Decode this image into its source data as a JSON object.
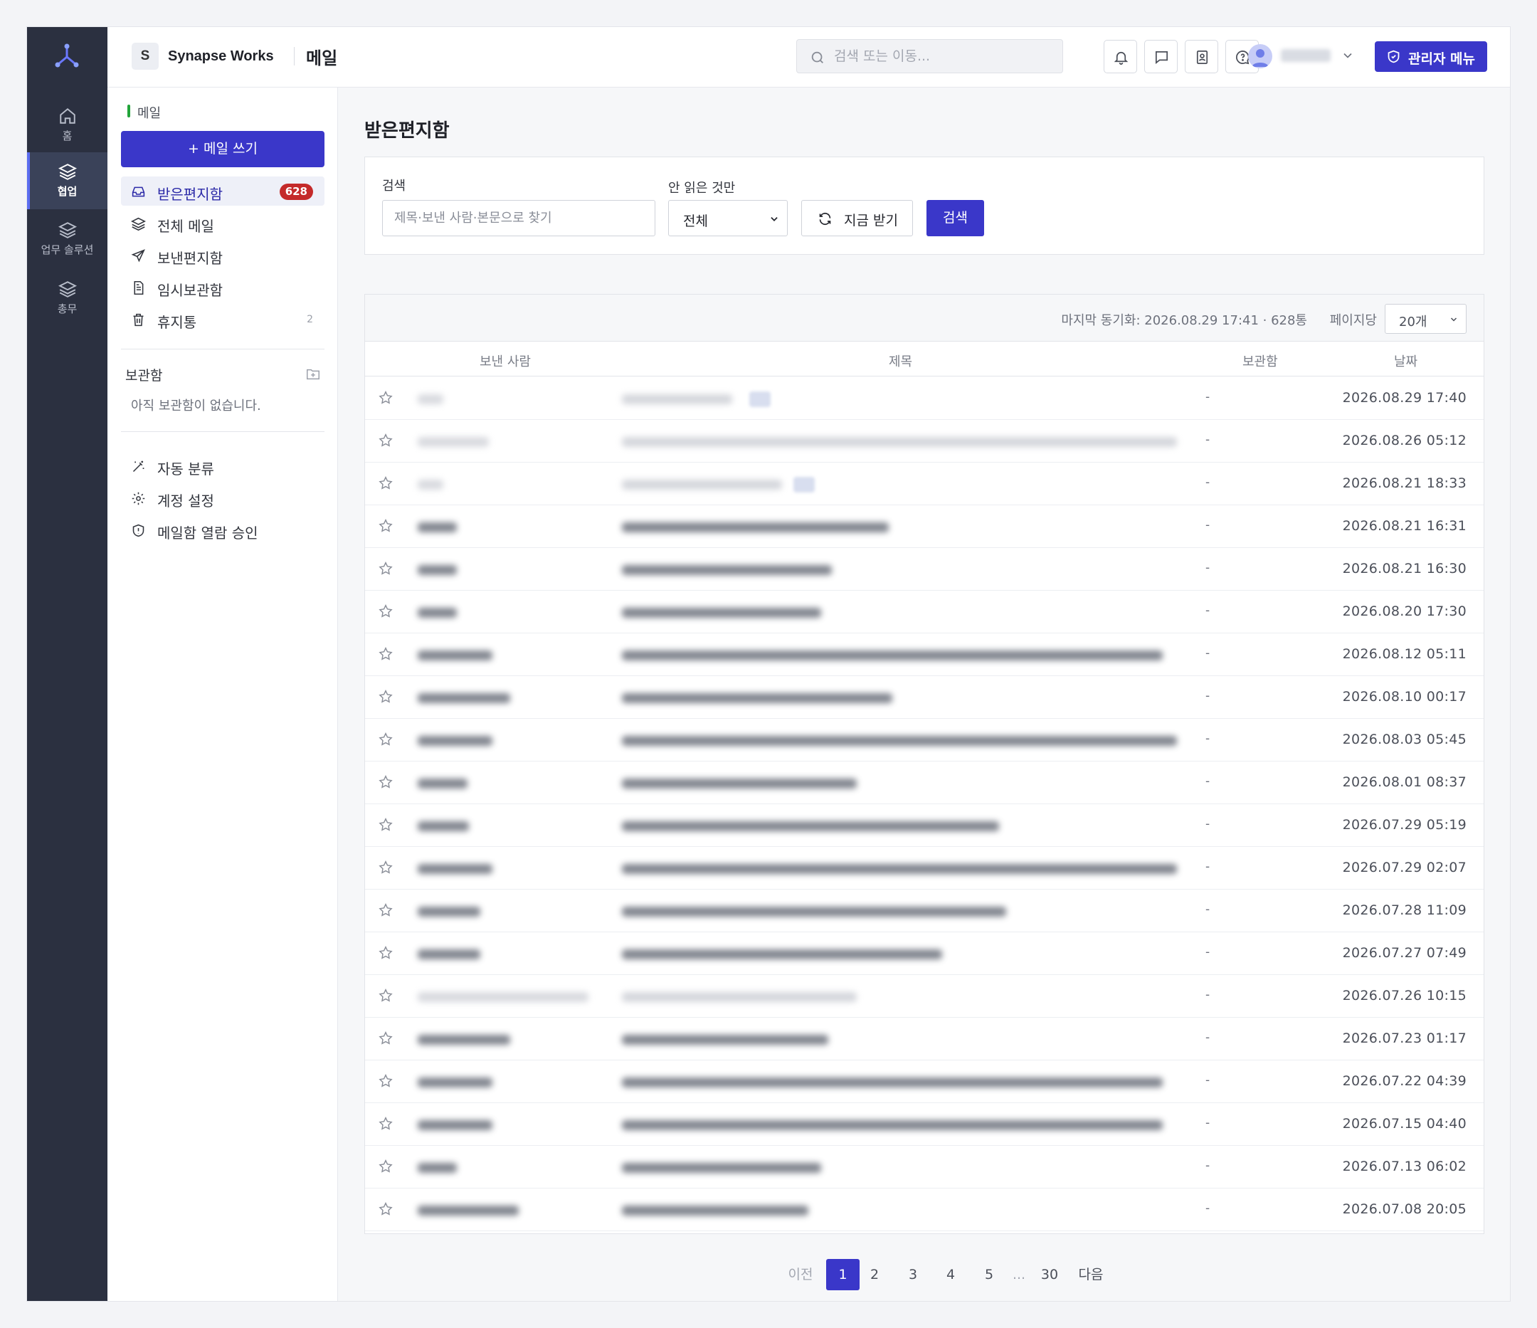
{
  "header": {
    "workspace_initial": "S",
    "workspace_name": "Synapse Works",
    "app_title": "메일",
    "search_placeholder": "검색 또는 이동...",
    "admin_label": "관리자 메뉴"
  },
  "rail": {
    "items": [
      {
        "label": "홈",
        "icon": "home-icon"
      },
      {
        "label": "협업",
        "icon": "layers-icon",
        "active": true
      },
      {
        "label": "업무 솔루션",
        "icon": "layers-icon"
      },
      {
        "label": "총무",
        "icon": "layers-icon"
      }
    ]
  },
  "sidebar": {
    "section_label": "메일",
    "compose_label": "+ 메일 쓰기",
    "nav": [
      {
        "label": "받은편지함",
        "icon": "inbox-icon",
        "badge": "628",
        "active": true
      },
      {
        "label": "전체 메일",
        "icon": "layers-icon"
      },
      {
        "label": "보낸편지함",
        "icon": "send-icon"
      },
      {
        "label": "임시보관함",
        "icon": "draft-icon"
      },
      {
        "label": "휴지통",
        "icon": "trash-icon",
        "count": "2"
      }
    ],
    "folders_title": "보관함",
    "folders_empty": "아직 보관함이 없습니다.",
    "tools": [
      {
        "label": "자동 분류",
        "icon": "magic-wand-icon"
      },
      {
        "label": "계정 설정",
        "icon": "gear-icon"
      },
      {
        "label": "메일함 열람 승인",
        "icon": "shield-icon"
      }
    ]
  },
  "main": {
    "page_title": "받은편지함",
    "filter": {
      "search_label": "검색",
      "search_placeholder": "제목·보낸 사람·본문으로 찾기",
      "unread_label": "안 읽은 것만",
      "unread_value": "전체",
      "refresh_label": "지금 받기",
      "search_button": "검색"
    },
    "list": {
      "sync_text": "마지막 동기화: 2026.08.29 17:41 · 628통",
      "per_page_label": "페이지당",
      "per_page_value": "20개",
      "columns": {
        "from": "보낸 사람",
        "subject": "제목",
        "folder": "보관함",
        "date": "날짜"
      },
      "rows": [
        {
          "folder": "-",
          "date": "2026.08.29 17:40"
        },
        {
          "folder": "-",
          "date": "2026.08.26 05:12"
        },
        {
          "folder": "-",
          "date": "2026.08.21 18:33"
        },
        {
          "folder": "-",
          "date": "2026.08.21 16:31"
        },
        {
          "folder": "-",
          "date": "2026.08.21 16:30"
        },
        {
          "folder": "-",
          "date": "2026.08.20 17:30"
        },
        {
          "folder": "-",
          "date": "2026.08.12 05:11"
        },
        {
          "folder": "-",
          "date": "2026.08.10 00:17"
        },
        {
          "folder": "-",
          "date": "2026.08.03 05:45"
        },
        {
          "folder": "-",
          "date": "2026.08.01 08:37"
        },
        {
          "folder": "-",
          "date": "2026.07.29 05:19"
        },
        {
          "folder": "-",
          "date": "2026.07.29 02:07"
        },
        {
          "folder": "-",
          "date": "2026.07.28 11:09"
        },
        {
          "folder": "-",
          "date": "2026.07.27 07:49"
        },
        {
          "folder": "-",
          "date": "2026.07.26 10:15"
        },
        {
          "folder": "-",
          "date": "2026.07.23 01:17"
        },
        {
          "folder": "-",
          "date": "2026.07.22 04:39"
        },
        {
          "folder": "-",
          "date": "2026.07.15 04:40"
        },
        {
          "folder": "-",
          "date": "2026.07.13 06:02"
        },
        {
          "folder": "-",
          "date": "2026.07.08 20:05"
        }
      ]
    },
    "pager": {
      "prev": "이전",
      "pages": [
        "1",
        "2",
        "3",
        "4",
        "5"
      ],
      "ellipsis": "...",
      "last": "30",
      "next": "다음",
      "current": "1"
    }
  },
  "colors": {
    "accent": "#3a37c9",
    "rail": "#2b3040",
    "badge": "#c42a2a"
  }
}
